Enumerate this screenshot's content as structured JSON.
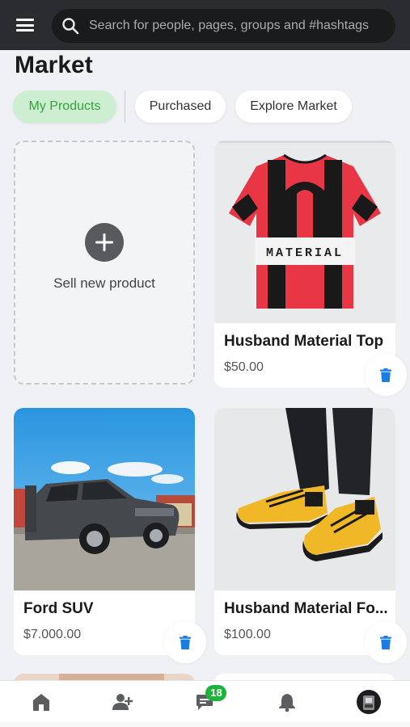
{
  "search": {
    "placeholder": "Search for people, pages, groups and #hashtags"
  },
  "page": {
    "title": "Market"
  },
  "tabs": [
    {
      "label": "My Products",
      "active": true
    },
    {
      "label": "Purchased",
      "active": false
    },
    {
      "label": "Explore Market",
      "active": false
    }
  ],
  "sell_card": {
    "label": "Sell new product"
  },
  "products": [
    {
      "name": "Husband Material Top",
      "price": "$50.00",
      "image": "red-black-striped-tshirt"
    },
    {
      "name": "Ford SUV",
      "price": "$7.000.00",
      "image": "grey-ford-suv"
    },
    {
      "name": "Husband Material Fo...",
      "price": "$100.00",
      "image": "yellow-black-sneakers"
    }
  ],
  "tshirt_print": "MATERIAL",
  "nav": {
    "messages_badge": "18"
  },
  "colors": {
    "accent_green": "#33a43b",
    "delete_blue": "#1a7de0",
    "topbar": "#2a2c2f"
  }
}
